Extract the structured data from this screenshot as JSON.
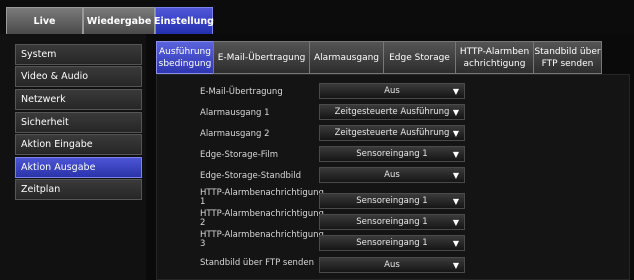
{
  "top_nav": {
    "live": "Live",
    "playback": "Wiedergabe",
    "settings": "Einstellung"
  },
  "sidebar": {
    "items": [
      {
        "label": "System"
      },
      {
        "label": "Video & Audio"
      },
      {
        "label": "Netzwerk"
      },
      {
        "label": "Sicherheit"
      },
      {
        "label": "Aktion Eingabe"
      },
      {
        "label": "Aktion Ausgabe"
      },
      {
        "label": "Zeitplan"
      }
    ],
    "active_index": 5
  },
  "subtabs": [
    {
      "line1": "Ausführung",
      "line2": "sbedingung"
    },
    {
      "line1": "E-Mail-Übertragung",
      "line2": ""
    },
    {
      "line1": "Alarmausgang",
      "line2": ""
    },
    {
      "line1": "Edge Storage",
      "line2": ""
    },
    {
      "line1": "HTTP-Alarmben",
      "line2": "achrichtigung"
    },
    {
      "line1": "Standbild über",
      "line2": "FTP senden"
    }
  ],
  "settings": [
    {
      "label": "E-Mail-Übertragung",
      "value": "Aus"
    },
    {
      "label": "Alarmausgang 1",
      "value": "Zeitgesteuerte Ausführung"
    },
    {
      "label": "Alarmausgang 2",
      "value": "Zeitgesteuerte Ausführung"
    },
    {
      "label": "Edge-Storage-Film",
      "value": "Sensoreingang 1"
    },
    {
      "label": "Edge-Storage-Standbild",
      "value": "Aus"
    },
    {
      "label": "HTTP-Alarmbenachrichtigung 1",
      "value": "Sensoreingang 1"
    },
    {
      "label": "HTTP-Alarmbenachrichtigung 2",
      "value": "Sensoreingang 1"
    },
    {
      "label": "HTTP-Alarmbenachrichtigung 3",
      "value": "Sensoreingang 1"
    },
    {
      "label": "Standbild über FTP senden",
      "value": "Aus"
    }
  ],
  "icons": {
    "dropdown": "caret-down-icon"
  },
  "colors": {
    "active_tab": "#2e36b0",
    "background": "#000000"
  }
}
